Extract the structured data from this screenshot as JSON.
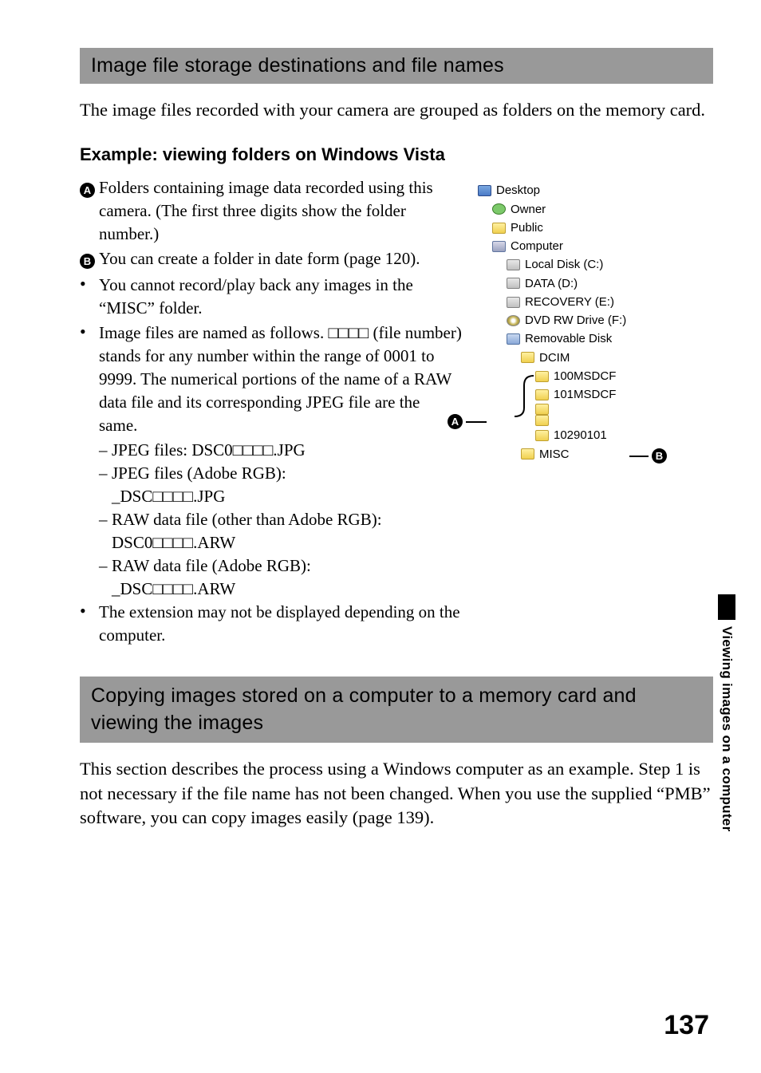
{
  "section1": {
    "title": "Image file storage destinations and file names",
    "intro": "The image files recorded with your camera are grouped as folders on the memory card.",
    "subhead": "Example: viewing folders on Windows Vista",
    "itemA": "Folders containing image data recorded using this camera. (The first three digits show the folder number.)",
    "itemB": "You can create a folder in date form (page 120).",
    "bullet1": "You cannot record/play back any images in the “MISC” folder.",
    "bullet2": "Image files are named as follows. □□□□ (file number) stands for any number within the range of 0001 to 9999. The numerical portions of the name of a RAW data file and its corresponding JPEG file are the same.",
    "sub1": "JPEG files: DSC0□□□□.JPG",
    "sub2a": "JPEG files (Adobe RGB):",
    "sub2b": "_DSC□□□□.JPG",
    "sub3a": "RAW data file (other than Adobe RGB):",
    "sub3b": "DSC0□□□□.ARW",
    "sub4a": "RAW data file (Adobe RGB):",
    "sub4b": "_DSC□□□□.ARW",
    "bullet3": "The extension may not be displayed depending on the computer."
  },
  "tree": {
    "desktop": "Desktop",
    "owner": "Owner",
    "public": "Public",
    "computer": "Computer",
    "localdisk": "Local Disk (C:)",
    "data": "DATA (D:)",
    "recovery": "RECOVERY (E:)",
    "dvd": "DVD RW Drive (F:)",
    "removable": "Removable Disk",
    "dcim": "DCIM",
    "f100": "100MSDCF",
    "f101": "101MSDCF",
    "fdate": "10290101",
    "misc": "MISC"
  },
  "callouts": {
    "A": "A",
    "B": "B"
  },
  "section2": {
    "title": "Copying images stored on a computer to a memory card and viewing the images",
    "intro": "This section describes the process using a Windows computer as an example. Step 1 is not necessary if the file name has not been changed. When you use the supplied “PMB” software, you can copy images easily (page 139)."
  },
  "sideTab": "Viewing images on a computer",
  "pageNumber": "137"
}
